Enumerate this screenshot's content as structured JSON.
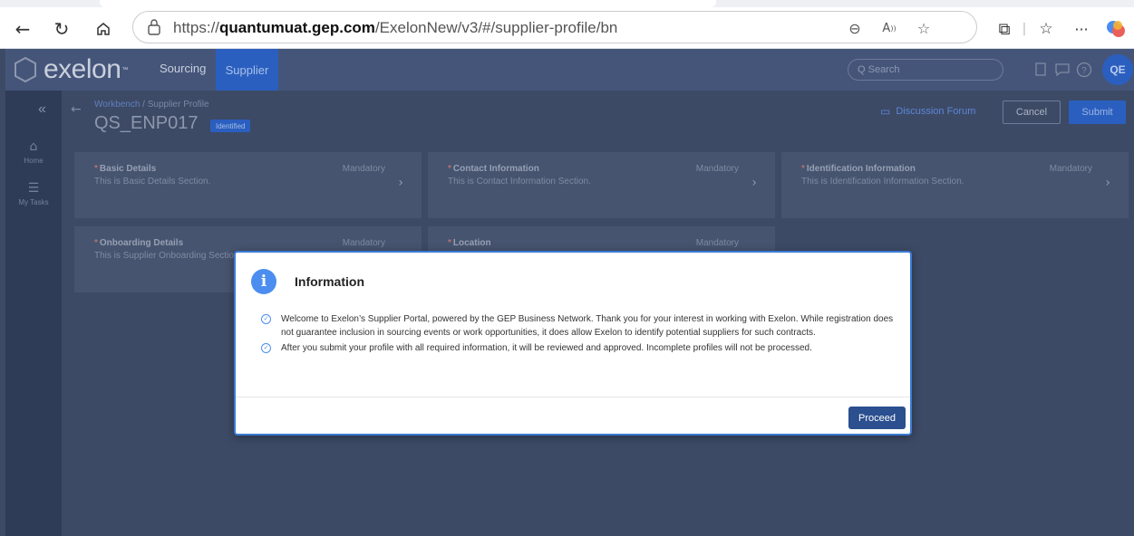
{
  "browser": {
    "url_prefix": "https://",
    "url_domain": "quantumuat.gep.com",
    "url_path": "/ExelonNew/v3/#/supplier-profile/bn",
    "back_icon": "arrow-left-icon",
    "refresh_icon": "refresh-icon",
    "home_icon": "home-icon",
    "more_label": "···"
  },
  "app": {
    "brand": "exelon",
    "brand_mark": "™",
    "nav": [
      "Sourcing",
      "Supplier"
    ],
    "search_placeholder": "Q Search",
    "avatar_initials": "QE"
  },
  "sidenav": {
    "collapse": "«",
    "items": [
      {
        "label": "Home",
        "icon": "home-icon"
      },
      {
        "label": "My Tasks",
        "icon": "tasks-icon"
      }
    ]
  },
  "header": {
    "breadcrumb_root": "Workbench",
    "breadcrumb_sep": " / ",
    "breadcrumb_current": "Supplier Profile",
    "title": "QS_ENP017",
    "status": "Identified",
    "forum": "Discussion Forum",
    "cancel": "Cancel",
    "submit": "Submit"
  },
  "cards": [
    {
      "title": "Basic Details",
      "desc": "This is Basic Details Section.",
      "tag": "Mandatory"
    },
    {
      "title": "Contact Information",
      "desc": "This is Contact Information Section.",
      "tag": "Mandatory"
    },
    {
      "title": "Identification Information",
      "desc": "This is Identification Information Section.",
      "tag": "Mandatory"
    },
    {
      "title": "Onboarding Details",
      "desc": "This is Supplier Onboarding Section.",
      "tag": "Mandatory"
    },
    {
      "title": "Location",
      "desc": "",
      "tag": "Mandatory"
    }
  ],
  "modal": {
    "title": "Information",
    "items": [
      "Welcome to Exelon’s Supplier Portal, powered by the GEP Business Network. Thank you for your interest in working with Exelon. While registration does not guarantee inclusion in sourcing events or work opportunities, it does allow Exelon to identify potential suppliers for such contracts.",
      "After you submit your profile with all required information, it will be reviewed and approved. Incomplete profiles will not be processed."
    ],
    "proceed": "Proceed"
  },
  "colors": {
    "accent": "#2b5fbf",
    "overlay": "#3d4a66",
    "modal_border": "#3a7bd5",
    "info_icon": "#4b8ef0"
  }
}
